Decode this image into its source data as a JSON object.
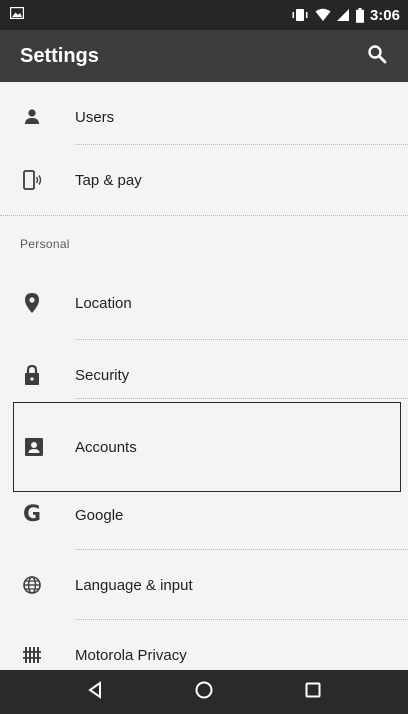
{
  "status_bar": {
    "time": "3:06",
    "icons": [
      "image-icon",
      "vibrate-icon",
      "wifi-icon",
      "signal-icon",
      "battery-icon"
    ]
  },
  "app_bar": {
    "title": "Settings",
    "search_icon": "search-icon"
  },
  "list": {
    "items_top": [
      {
        "label": "Users",
        "icon": "person-icon"
      },
      {
        "label": "Tap & pay",
        "icon": "tap-pay-icon"
      }
    ],
    "section_header": "Personal",
    "items_personal": [
      {
        "label": "Location",
        "icon": "location-pin-icon"
      },
      {
        "label": "Security",
        "icon": "lock-icon"
      },
      {
        "label": "Accounts",
        "icon": "account-box-icon"
      },
      {
        "label": "Google",
        "icon": "google-g-icon",
        "glyph": "G"
      },
      {
        "label": "Language & input",
        "icon": "globe-icon"
      },
      {
        "label": "Motorola Privacy",
        "icon": "motorola-privacy-icon"
      }
    ]
  },
  "nav_bar": {
    "buttons": [
      "back-icon",
      "home-icon",
      "recents-icon"
    ]
  },
  "colors": {
    "status_bar": "#262626",
    "app_bar": "#3d3d3d",
    "background": "#f4f4f4",
    "nav_bar": "#2a2a2a"
  }
}
